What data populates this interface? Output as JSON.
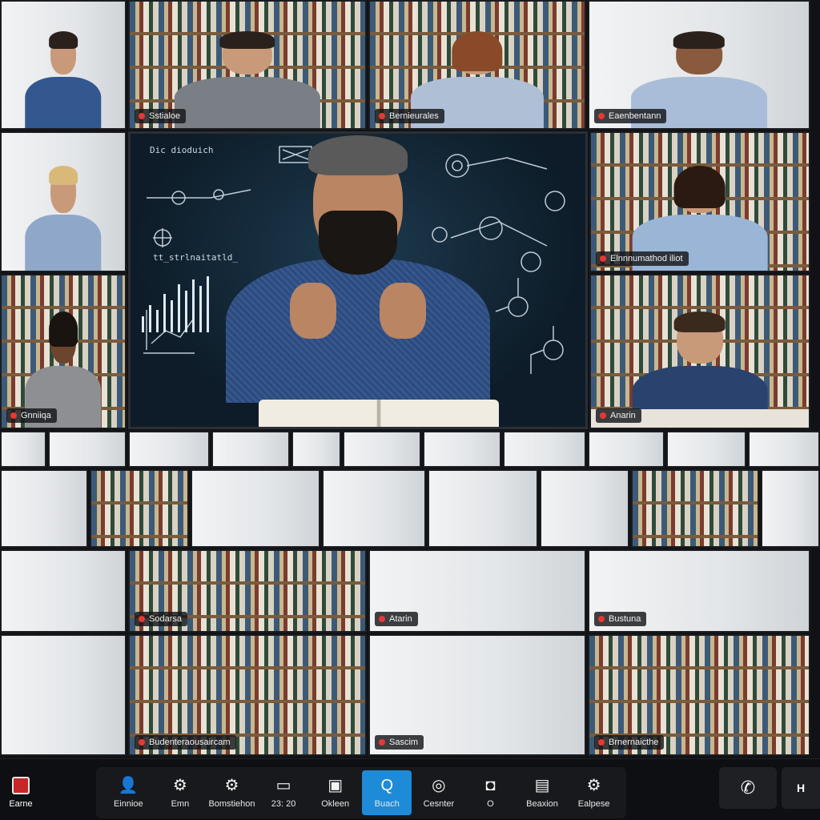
{
  "participants": {
    "top_row": [
      {
        "name": ""
      },
      {
        "name": "Sstialoe"
      },
      {
        "name": "Bernieurales"
      },
      {
        "name": "Eaenbentann"
      }
    ],
    "left_column": [
      {
        "name": ""
      },
      {
        "name": "Gnniiqa"
      }
    ],
    "right_column": [
      {
        "name": "Elnnnumathod iliot"
      },
      {
        "name": "Anarin"
      }
    ],
    "lower_grid": [
      {
        "name": "Sodarsa"
      },
      {
        "name": "Atarin"
      },
      {
        "name": "Bustuna"
      },
      {
        "name": "Budenteraousaircam"
      },
      {
        "name": "Sascim"
      },
      {
        "name": "Brnernaicthe"
      }
    ]
  },
  "main_speaker": {
    "board_title": "Dic dioduich",
    "board_note": "tt_strlnaitatld_"
  },
  "toolbar": {
    "left_label": "Earne",
    "items": [
      {
        "icon": "person-icon",
        "glyph": "👤",
        "label": "Einnioe"
      },
      {
        "icon": "gear-icon",
        "glyph": "⚙",
        "label": "Emn"
      },
      {
        "icon": "gear-icon",
        "glyph": "⚙",
        "label": "Bomstiehon"
      },
      {
        "icon": "chat-icon",
        "glyph": "▭",
        "label": "23: 20"
      },
      {
        "icon": "screen-icon",
        "glyph": "▣",
        "label": "Okleen"
      },
      {
        "icon": "search-icon",
        "glyph": "Q",
        "label": "Buach",
        "active": true
      },
      {
        "icon": "spiral-icon",
        "glyph": "◎",
        "label": "Cesnter"
      },
      {
        "icon": "camera-icon",
        "glyph": "◘",
        "label": "O"
      },
      {
        "icon": "window-icon",
        "glyph": "▤",
        "label": "Beaxion"
      },
      {
        "icon": "gear-icon",
        "glyph": "⚙",
        "label": "Ealpese"
      }
    ],
    "call_glyph": "✆",
    "right_label": "H"
  },
  "colors": {
    "accent": "#1d8bd8",
    "mic_muted": "#e53935",
    "toolbar_bg": "#0e0f12"
  }
}
